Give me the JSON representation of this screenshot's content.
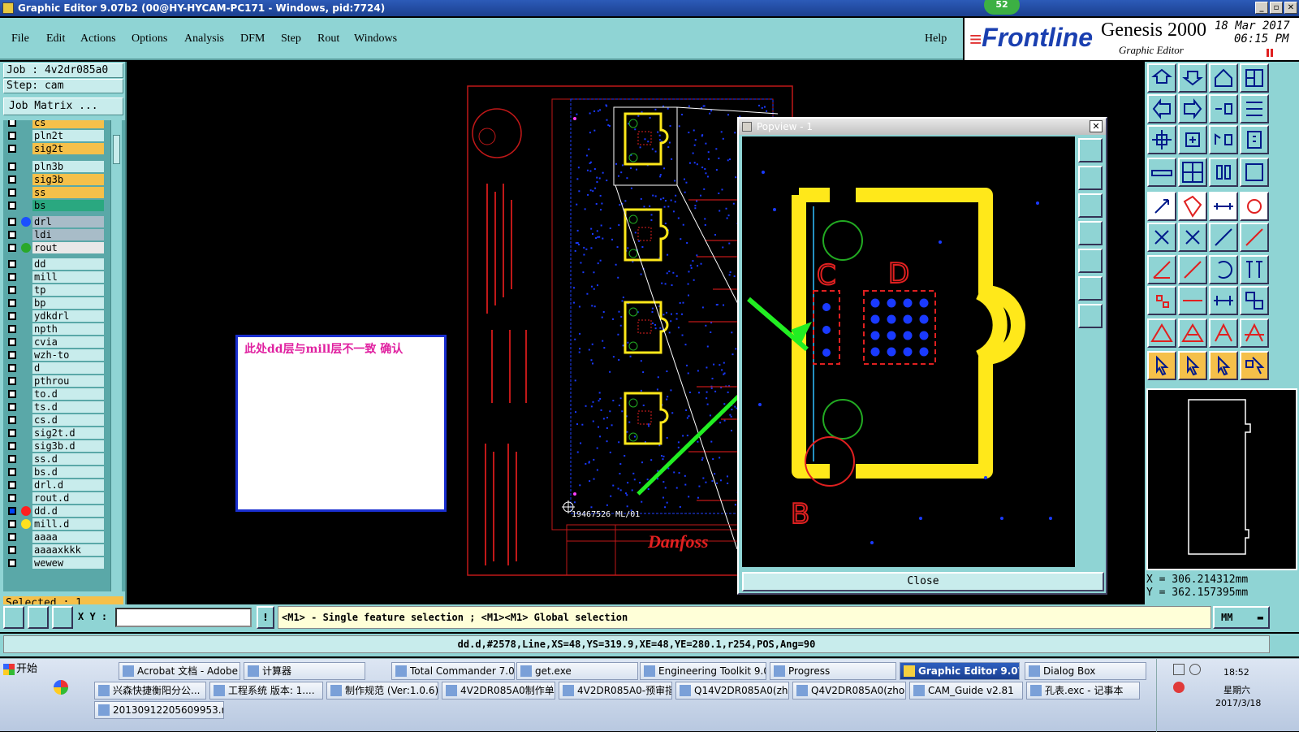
{
  "window": {
    "title": "Graphic Editor 9.07b2 (00@HY-HYCAM-PC171 - Windows, pid:7724)",
    "badge": "52"
  },
  "menu": [
    "File",
    "Edit",
    "Actions",
    "Options",
    "Analysis",
    "DFM",
    "Step",
    "Rout",
    "Windows"
  ],
  "help": "Help",
  "brand": {
    "logo": "Frontline",
    "product": "Genesis 2000",
    "subtitle": "Graphic Editor",
    "date": "18 Mar 2017",
    "time": "06:15 PM"
  },
  "job": {
    "job_line": "Job : 4v2dr085a0",
    "step_line": "Step: cam",
    "matrix_button": "Job Matrix ..."
  },
  "layers": [
    {
      "name": "cs",
      "color": "#f5c04a"
    },
    {
      "name": "pln2t",
      "color": "#c8ecec"
    },
    {
      "name": "sig2t",
      "color": "#f5c04a"
    },
    {
      "name": "pln3b",
      "color": "#c8ecec"
    },
    {
      "name": "sig3b",
      "color": "#f5c04a"
    },
    {
      "name": "ss",
      "color": "#f5c04a"
    },
    {
      "name": "bs",
      "color": "#2aa880"
    },
    {
      "name": "drl",
      "color": "#a8bcc8",
      "dot": "#1a50ff"
    },
    {
      "name": "ldi",
      "color": "#a8bcc8"
    },
    {
      "name": "rout",
      "color": "#e8e8e8",
      "dot": "#2aa82a"
    },
    {
      "name": "dd",
      "color": "#c8ecec"
    },
    {
      "name": "mill",
      "color": "#c8ecec"
    },
    {
      "name": "tp",
      "color": "#c8ecec"
    },
    {
      "name": "bp",
      "color": "#c8ecec"
    },
    {
      "name": "ydkdrl",
      "color": "#c8ecec"
    },
    {
      "name": "npth",
      "color": "#c8ecec"
    },
    {
      "name": "cvia",
      "color": "#c8ecec"
    },
    {
      "name": "wzh-to",
      "color": "#c8ecec"
    },
    {
      "name": "d",
      "color": "#c8ecec"
    },
    {
      "name": "pthrou",
      "color": "#c8ecec"
    },
    {
      "name": "to.d",
      "color": "#c8ecec"
    },
    {
      "name": "ts.d",
      "color": "#c8ecec"
    },
    {
      "name": "cs.d",
      "color": "#c8ecec"
    },
    {
      "name": "sig2t.d",
      "color": "#c8ecec"
    },
    {
      "name": "sig3b.d",
      "color": "#c8ecec"
    },
    {
      "name": "ss.d",
      "color": "#c8ecec"
    },
    {
      "name": "bs.d",
      "color": "#c8ecec"
    },
    {
      "name": "drl.d",
      "color": "#c8ecec"
    },
    {
      "name": "rout.d",
      "color": "#c8ecec"
    },
    {
      "name": "dd.d",
      "color": "#c8ecec",
      "dot": "#ff2020"
    },
    {
      "name": "mill.d",
      "color": "#c8ecec",
      "dot": "#ffe020"
    },
    {
      "name": "aaaa",
      "color": "#c8ecec"
    },
    {
      "name": "aaaaxkkk",
      "color": "#c8ecec"
    },
    {
      "name": "wewew",
      "color": "#c8ecec"
    }
  ],
  "selected": "Selected : 1",
  "note": "此处dd层与mill层不一致   确认",
  "board": {
    "silk_label": "19467526 ML/01"
  },
  "popview": {
    "title": "Popview - 1",
    "close_button": "Close",
    "labels": [
      "C",
      "D",
      "B"
    ]
  },
  "coords": {
    "x": "X = 306.214312mm",
    "y": "Y = 362.157395mm"
  },
  "cmd": {
    "xy_label": "X Y :",
    "xy_value": "",
    "hint": "<M1> - Single feature selection ; <M1><M1> Global selection",
    "unit": "MM"
  },
  "status": "dd.d,#2578,Line,XS=48,YS=319.9,XE=48,YE=280.1,r254,POS,Ang=90",
  "taskbar": {
    "start": "开始",
    "row1": [
      "Acrobat 文档 - Adobe ...",
      "计算器",
      "Total Commander 7.0 p...",
      "get.exe",
      "Engineering Toolkit 9.0...",
      "Progress",
      "Graphic Editor 9.07b...",
      "Dialog Box"
    ],
    "row2": [
      "兴森快捷衡阳分公...",
      "工程系统  版本: 1....",
      "制作规范 (Ver:1.0.6)",
      "4V2DR085A0制作单....",
      "4V2DR085A0-预审指...",
      "Q14V2DR085A0(zho...",
      "Q4V2DR085A0(zhou...",
      "CAM_Guide v2.81",
      "孔表.exc - 记事本"
    ],
    "row3": [
      "20130912205609953.rtf..."
    ],
    "clock": "18:52",
    "weekday": "星期六",
    "date": "2017/3/18"
  }
}
